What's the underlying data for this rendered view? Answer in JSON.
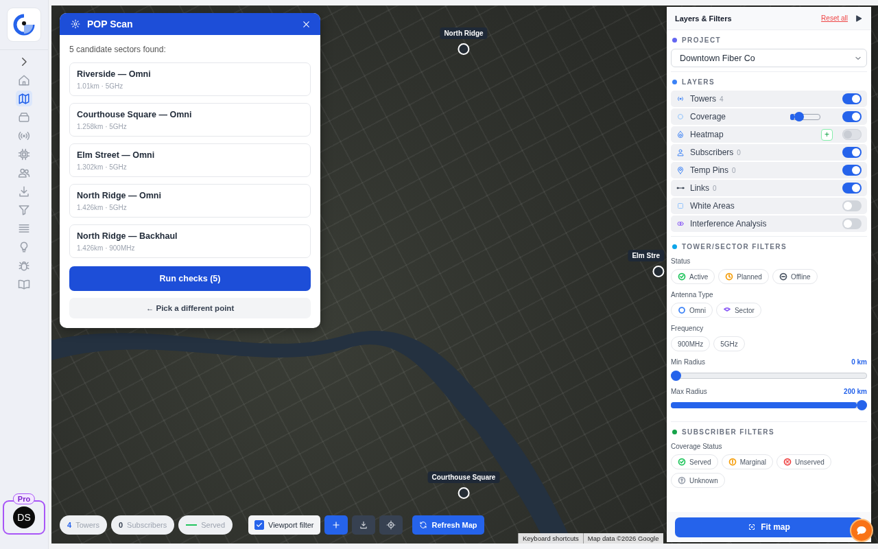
{
  "sidebar": {
    "nav_items": [
      {
        "selected": false
      },
      {
        "selected": true
      },
      {
        "selected": false
      },
      {
        "selected": false
      },
      {
        "selected": false
      },
      {
        "selected": false
      },
      {
        "selected": false
      },
      {
        "selected": false
      },
      {
        "selected": false
      },
      {
        "selected": false
      },
      {
        "selected": false
      },
      {
        "selected": false
      }
    ],
    "plan_badge": "Pro",
    "avatar_initials": "DS"
  },
  "pop_scan": {
    "title": "POP Scan",
    "summary": "5 candidate sectors found:",
    "candidates": [
      {
        "name": "Riverside — Omni",
        "detail": "1.01km · 5GHz"
      },
      {
        "name": "Courthouse Square — Omni",
        "detail": "1.258km · 5GHz"
      },
      {
        "name": "Elm Street — Omni",
        "detail": "1.302km · 5GHz"
      },
      {
        "name": "North Ridge — Omni",
        "detail": "1.426km · 5GHz"
      },
      {
        "name": "North Ridge — Backhaul",
        "detail": "1.426km · 900MHz"
      }
    ],
    "primary_button": "Run checks (5)",
    "secondary_button": "← Pick a different point"
  },
  "map": {
    "markers": [
      {
        "label": "North Ridge"
      },
      {
        "label": "Elm Stre"
      },
      {
        "label": "Courthouse Square"
      }
    ],
    "attribution": [
      "Keyboard shortcuts",
      "Map data ©2026 Google"
    ]
  },
  "bottom_bar": {
    "stats": [
      {
        "kind": "count",
        "value": "4",
        "label": "Towers"
      },
      {
        "kind": "count",
        "value": "0",
        "label": "Subscribers"
      },
      {
        "kind": "legend",
        "label": "Served"
      }
    ],
    "viewport_filter": {
      "label": "Viewport filter",
      "checked": true
    },
    "refresh_button": "Refresh Map"
  },
  "layers_panel": {
    "title": "Layers & Filters",
    "reset_link": "Reset all",
    "project": {
      "heading": "PROJECT",
      "color": "#6366f1",
      "value": "Downtown Fiber Co"
    },
    "layers": {
      "heading": "LAYERS",
      "color": "#3b82f6",
      "items": [
        {
          "kind": "count",
          "label": "Towers",
          "count": "4",
          "on": true,
          "disabled": false
        },
        {
          "kind": "slider",
          "label": "Coverage",
          "level": 0.2,
          "on": true,
          "disabled": false
        },
        {
          "kind": "add",
          "label": "Heatmap",
          "add_button": "+",
          "on": false,
          "disabled": true
        },
        {
          "kind": "count",
          "label": "Subscribers",
          "count": "0",
          "on": true,
          "disabled": false
        },
        {
          "kind": "count",
          "label": "Temp Pins",
          "count": "0",
          "on": true,
          "disabled": false
        },
        {
          "kind": "count",
          "label": "Links",
          "count": "0",
          "on": true,
          "disabled": false
        },
        {
          "kind": "plain",
          "label": "White Areas",
          "on": false,
          "disabled": false
        },
        {
          "kind": "plain",
          "label": "Interference Analysis",
          "on": false,
          "disabled": false
        }
      ]
    },
    "tower_filters": {
      "heading": "TOWER/SECTOR FILTERS",
      "color": "#0ea5e9",
      "groups": [
        {
          "label": "Status",
          "chips": [
            {
              "kind": "check",
              "label": "Active",
              "color": "#22c55e"
            },
            {
              "kind": "clock",
              "label": "Planned",
              "color": "#f59e0b"
            },
            {
              "kind": "minus",
              "label": "Offline",
              "color": "#4b5563"
            }
          ]
        },
        {
          "label": "Antenna Type",
          "chips": [
            {
              "kind": "ring",
              "label": "Omni",
              "color": "#3b82f6"
            },
            {
              "kind": "sector",
              "label": "Sector",
              "color": "#8b5cf6"
            }
          ]
        },
        {
          "label": "Frequency",
          "chips": [
            {
              "kind": "plain",
              "label": "900MHz"
            },
            {
              "kind": "plain",
              "label": "5GHz"
            }
          ]
        }
      ],
      "sliders": [
        {
          "label": "Min Radius",
          "reading": "0 km",
          "level": 0
        },
        {
          "label": "Max Radius",
          "reading": "200 km",
          "level": 1
        }
      ]
    },
    "subscriber_filters": {
      "heading": "SUBSCRIBER FILTERS",
      "color": "#16a34a",
      "groups": [
        {
          "label": "Coverage Status",
          "chips": [
            {
              "kind": "check",
              "label": "Served",
              "color": "#22c55e"
            },
            {
              "kind": "alert",
              "label": "Marginal",
              "color": "#f59e0b"
            },
            {
              "kind": "cross",
              "label": "Unserved",
              "color": "#ef4444"
            },
            {
              "kind": "question",
              "label": "Unknown",
              "color": "#9ca3af"
            }
          ]
        }
      ]
    },
    "fit_button": "Fit map"
  }
}
